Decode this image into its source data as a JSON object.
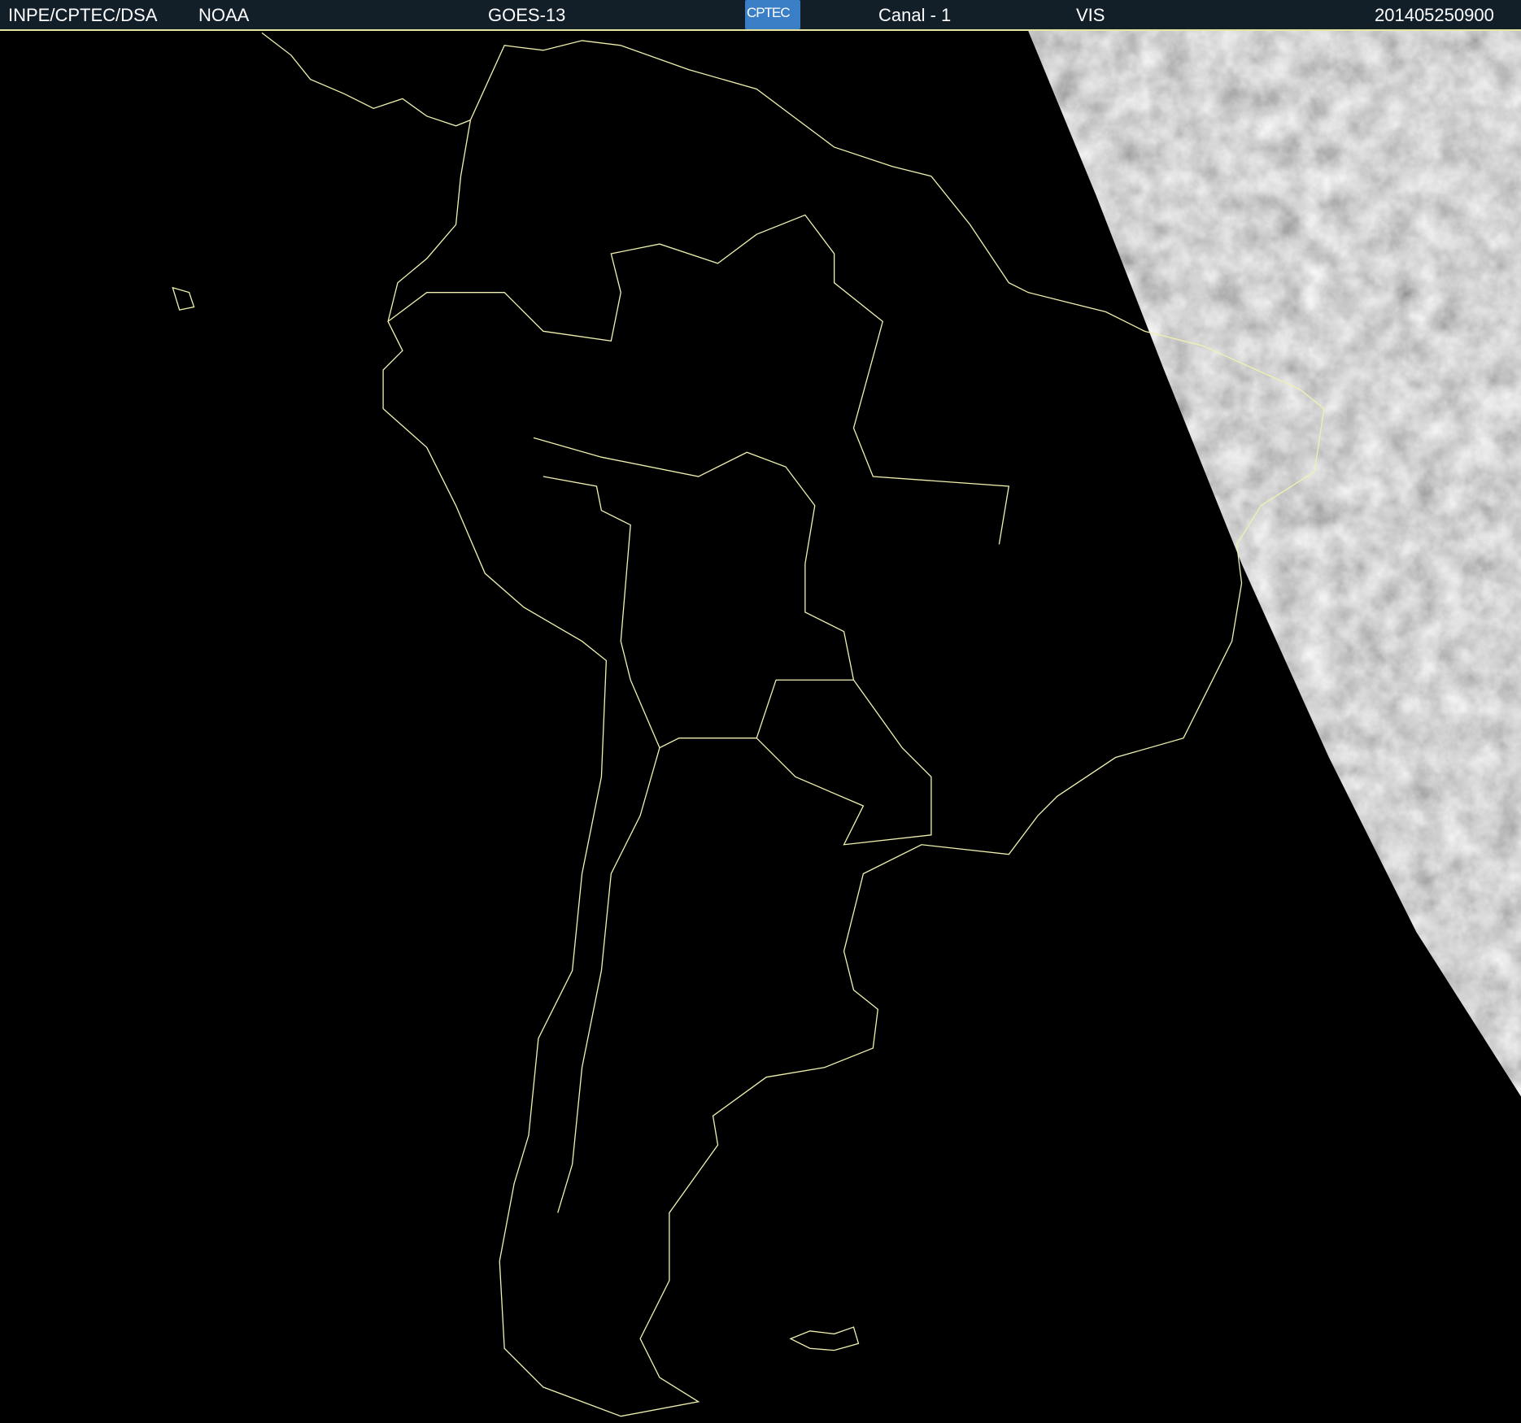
{
  "header": {
    "agency": "INPE/CPTEC/DSA",
    "provider": "NOAA",
    "satellite": "GOES-13",
    "logo_text": "CPTEC",
    "channel": "Canal - 1",
    "band": "VIS",
    "timestamp": "201405250900"
  },
  "map": {
    "region": "South America",
    "coastline_color": "#f0f0b0",
    "night_color": "#000000",
    "cloud_color": "#9a9a9a"
  }
}
